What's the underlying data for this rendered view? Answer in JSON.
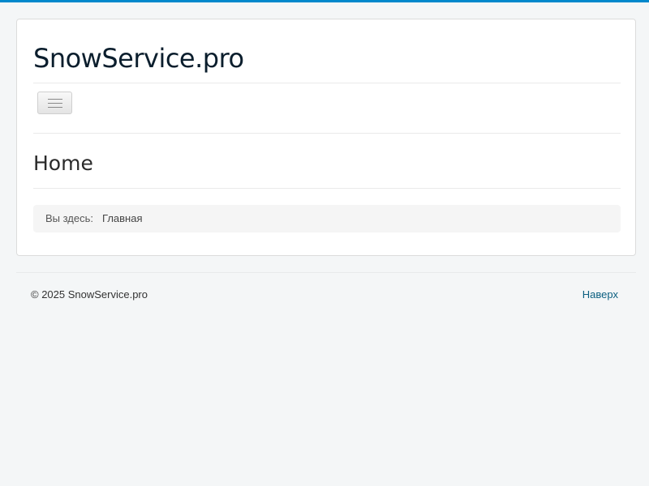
{
  "header": {
    "site_title": "SnowService.pro",
    "menu_toggle_icon": "hamburger-menu-icon"
  },
  "main": {
    "page_heading": "Home",
    "breadcrumb": {
      "prefix": "Вы здесь:",
      "items": [
        "Главная"
      ]
    }
  },
  "footer": {
    "copyright": "© 2025 SnowService.pro",
    "back_to_top": "Наверх"
  },
  "colors": {
    "accent_bar": "#0088cc",
    "link": "#0b5f80",
    "background": "#f4f6f7"
  }
}
